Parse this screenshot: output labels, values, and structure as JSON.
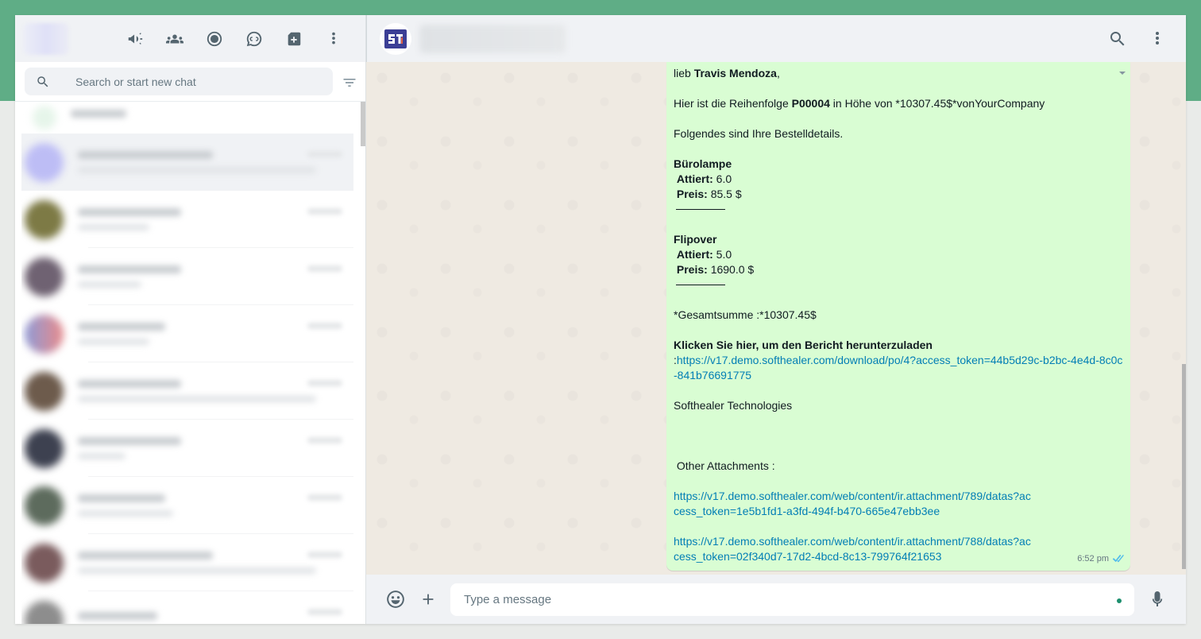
{
  "search": {
    "placeholder": "Search or start new chat"
  },
  "chats_count_visual": 9,
  "chat": {
    "greeting_prefix": "lieb ",
    "customer_name": "Travis Mendoza",
    "greeting_suffix": ",",
    "order_prefix": "Hier ist die Reihenfolge ",
    "order_number": "P00004",
    "order_suffix": " in Höhe von  *10307.45$*vonYourCompany",
    "details_intro": "Folgendes sind Ihre Bestelldetails.",
    "items": [
      {
        "name": "Bürolampe",
        "qty_label": "Attiert:",
        "qty": " 6.0",
        "price_label": "Preis:",
        "price": " 85.5 $"
      },
      {
        "name": "Flipover",
        "qty_label": "Attiert:",
        "qty": " 5.0",
        "price_label": "Preis:",
        "price": " 1690.0 $"
      }
    ],
    "total_text": "*Gesamtsumme :*10307.45$",
    "download_label": "Klicken Sie hier, um den Bericht herunterzuladen",
    "download_prefix": ":",
    "download_link": "https://v17.demo.softhealer.com/download/po/4?access_token=44b5d29c-b2bc-4e4d-8c0c-841b76691775",
    "signature": "Softhealer Technologies",
    "attachments_label": " Other Attachments :",
    "attachment_links": [
      "https://v17.demo.softhealer.com/web/content/ir.attachment/789/datas?access_token=1e5b1fd1-a3fd-494f-b470-665e47ebb3ee",
      "https://v17.demo.softhealer.com/web/content/ir.attachment/788/datas?access_token=02f340d7-17d2-4bcd-8c13-799764f21653"
    ],
    "time": "6:52 pm"
  },
  "composer": {
    "placeholder": "Type a message"
  },
  "colors": {
    "brand_green": "#5fad86",
    "bubble_out": "#d9fdd3",
    "link": "#027eb5",
    "read_tick": "#53bdeb"
  },
  "icons": {
    "header_left": [
      "megaphone-icon",
      "communities-icon",
      "status-icon",
      "channels-icon",
      "new-chat-icon",
      "menu-icon"
    ],
    "header_right": [
      "search-icon",
      "menu-icon"
    ],
    "composer": [
      "emoji-icon",
      "attach-plus-icon",
      "mic-icon"
    ]
  }
}
